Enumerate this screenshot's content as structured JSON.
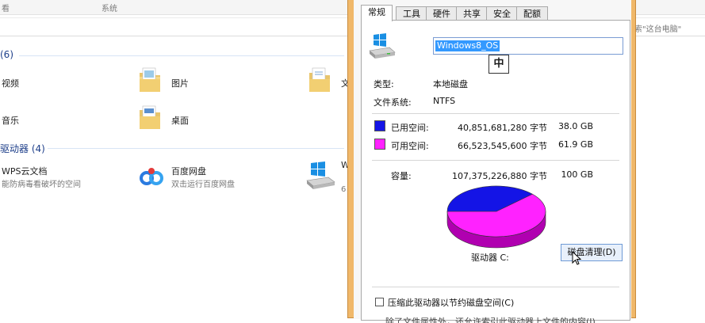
{
  "explorer": {
    "ribbon_label_left": "看",
    "ribbon_label_system": "系统",
    "search_hint": "索\"这台电脑\"",
    "folders_group": "(6)",
    "devices_group": "驱动器 (4)",
    "items": {
      "videos": "视频",
      "pictures": "图片",
      "documents_partial": "文",
      "music": "音乐",
      "desktop": "桌面",
      "wps_name": "WPS云文档",
      "wps_desc": "能防病毒看破坏的空间",
      "baidu_name": "百度网盘",
      "baidu_desc": "双击运行百度网盘",
      "drive_partial_name": "W",
      "drive_partial_sub": "6"
    }
  },
  "dialog": {
    "tabs": [
      "常规",
      "工具",
      "硬件",
      "共享",
      "安全",
      "配额"
    ],
    "active_tab": "常规",
    "name_value": "Windows8_OS",
    "ime_indicator": "中",
    "type_label": "类型:",
    "type_value": "本地磁盘",
    "fs_label": "文件系统:",
    "fs_value": "NTFS",
    "used_label": "已用空间:",
    "used_bytes": "40,851,681,280 字节",
    "used_size": "38.0 GB",
    "free_label": "可用空间:",
    "free_bytes": "66,523,545,600 字节",
    "free_size": "61.9 GB",
    "capacity_label": "容量:",
    "capacity_bytes": "107,375,226,880 字节",
    "capacity_size": "100 GB",
    "drive_label": "驱动器 C:",
    "cleanup_button": "磁盘清理(D)",
    "compress_label": "压缩此驱动器以节约磁盘空间(C)",
    "index_label_partial": "除了文件属性外，还允许索引此驱动器上文件的内容(I)",
    "colors": {
      "used": "#1414e6",
      "free": "#ff22ff",
      "used_side": "#0a0a8c",
      "free_side": "#b000b0",
      "frame": "#f0b86a"
    }
  },
  "chart_data": {
    "type": "pie",
    "categories": [
      "已用空间",
      "可用空间"
    ],
    "values": [
      38.0,
      61.9
    ]
  }
}
